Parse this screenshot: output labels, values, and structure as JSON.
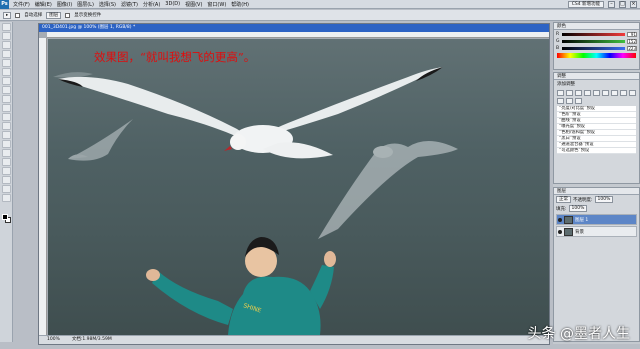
{
  "app": {
    "logo": "Ps",
    "menus": [
      "文件(F)",
      "编辑(E)",
      "图像(I)",
      "图层(L)",
      "选择(S)",
      "滤镜(T)",
      "分析(A)",
      "3D(D)",
      "视图(V)",
      "窗口(W)",
      "帮助(H)"
    ],
    "workspace": "CS4 新增功能",
    "minimize": "–",
    "maximize": "□",
    "close": "×"
  },
  "options": {
    "tool_preset": "▸",
    "auto_select_label": "自动选择",
    "auto_select_target": "图层",
    "show_transform_label": "显示变换控件"
  },
  "document": {
    "title": "001_3D401.jpg @ 100% (图层 1, RGB/8) *",
    "caption": "效果图，“就叫我想飞的更高”。",
    "status_zoom": "100%",
    "status_info": "文档:1.98M/3.59M"
  },
  "color_panel": {
    "tab": "颜色",
    "r_label": "R",
    "r_value": "91",
    "g_label": "G",
    "g_value": "152",
    "b_label": "B",
    "b_value": "223"
  },
  "adjust_panel": {
    "tab": "调整",
    "subtitle": "添加调整",
    "presets": [
      "“亮度/对比度”预设",
      "“色阶”预设",
      "“曲线”预设",
      "“曝光度”预设",
      "“色相/饱和度”预设",
      "“黑白”预设",
      "“通道混合器”预设",
      "“可选颜色”预设"
    ]
  },
  "layers_panel": {
    "tab": "图层",
    "blend_mode": "正常",
    "opacity_label": "不透明度:",
    "opacity_value": "100%",
    "fill_label": "填充:",
    "fill_value": "100%",
    "layers": [
      {
        "name": "图层 1",
        "active": true
      },
      {
        "name": "背景",
        "active": false
      }
    ]
  },
  "watermark": "头条 @墨者人生",
  "colors": {
    "accent": "#2d63c4",
    "caption_red": "#e00d0d",
    "fg_r": "#f23b3b",
    "fg_g": "#3fbf3f",
    "fg_b": "#3b6bf2"
  }
}
